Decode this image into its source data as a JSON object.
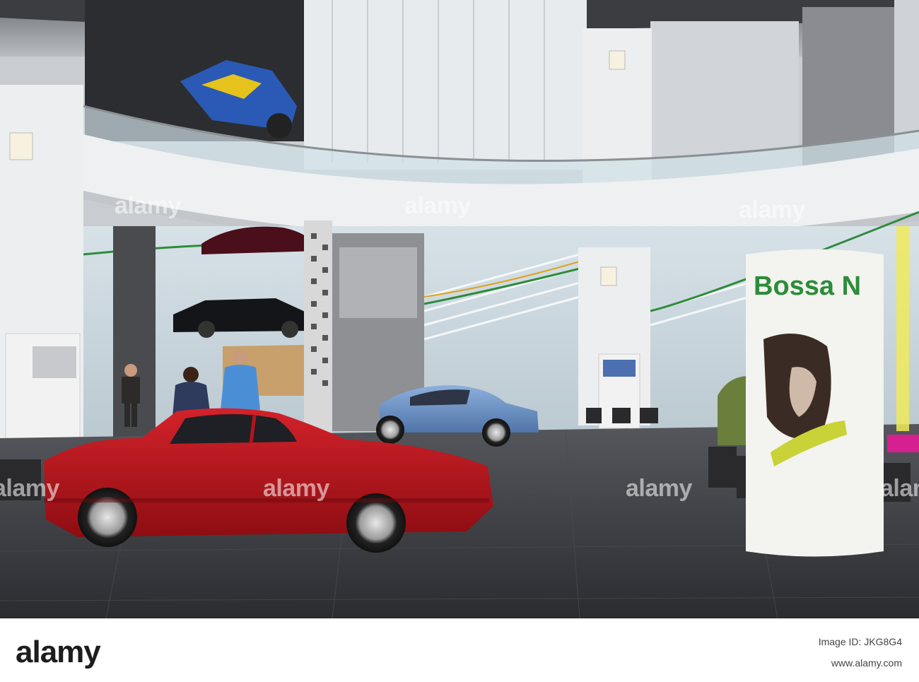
{
  "image": {
    "description": "Interior of an automobile museum atrium with classic cars on display"
  },
  "banner": {
    "text": "Bossa N"
  },
  "watermarks": [
    "alamy",
    "alamy",
    "alamy",
    "alamy",
    "alamy",
    "alamy",
    "alamy",
    "alamy",
    "alamy"
  ],
  "footer": {
    "logo": "alamy",
    "image_id": "Image ID: JKG8G4",
    "url": "www.alamy.com"
  },
  "colors": {
    "red_car": "#b3141a",
    "blue_car": "#6a8fc4",
    "banner_green": "#2c8c3a",
    "floor": "#3a3b3f"
  }
}
